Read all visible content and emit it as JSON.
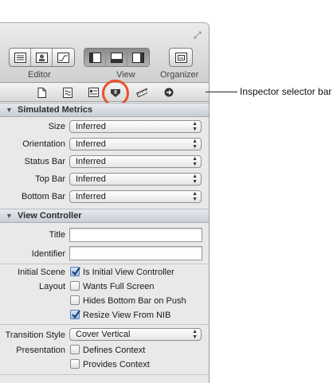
{
  "toolbar": {
    "editor_label": "Editor",
    "view_label": "View",
    "organizer_label": "Organizer"
  },
  "callout": {
    "text": "Inspector selector bar"
  },
  "inspector_tabs": [
    "file",
    "quick-help",
    "identity",
    "attributes",
    "size",
    "connections"
  ],
  "simulated_metrics": {
    "title": "Simulated Metrics",
    "size_label": "Size",
    "size_value": "Inferred",
    "orientation_label": "Orientation",
    "orientation_value": "Inferred",
    "status_bar_label": "Status Bar",
    "status_bar_value": "Inferred",
    "top_bar_label": "Top Bar",
    "top_bar_value": "Inferred",
    "bottom_bar_label": "Bottom Bar",
    "bottom_bar_value": "Inferred"
  },
  "view_controller": {
    "title": "View Controller",
    "title_label": "Title",
    "title_value": "",
    "identifier_label": "Identifier",
    "identifier_value": "",
    "initial_scene_label": "Initial Scene",
    "is_initial_label": "Is Initial View Controller",
    "is_initial_checked": true,
    "layout_label": "Layout",
    "wants_full_screen_label": "Wants Full Screen",
    "wants_full_screen_checked": false,
    "hides_bottom_bar_label": "Hides Bottom Bar on Push",
    "hides_bottom_bar_checked": false,
    "resize_view_label": "Resize View From NIB",
    "resize_view_checked": true,
    "transition_style_label": "Transition Style",
    "transition_style_value": "Cover Vertical",
    "presentation_label": "Presentation",
    "defines_context_label": "Defines Context",
    "defines_context_checked": false,
    "provides_context_label": "Provides Context",
    "provides_context_checked": false
  },
  "colors": {
    "highlight_ring": "#e8512c",
    "panel_bg": "#e9e9e9"
  }
}
